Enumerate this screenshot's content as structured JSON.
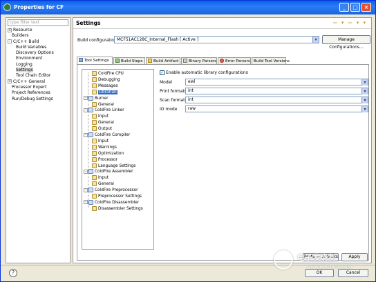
{
  "window": {
    "title": "Properties for CF"
  },
  "filter": {
    "placeholder": "type filter text"
  },
  "nav": [
    {
      "label": "Resource",
      "toggle": "+",
      "indent": 0
    },
    {
      "label": "Builders",
      "toggle": "",
      "indent": 1
    },
    {
      "label": "C/C++ Build",
      "toggle": "-",
      "indent": 0
    },
    {
      "label": "Build Variables",
      "toggle": "",
      "indent": 2
    },
    {
      "label": "Discovery Options",
      "toggle": "",
      "indent": 2
    },
    {
      "label": "Environment",
      "toggle": "",
      "indent": 2
    },
    {
      "label": "Logging",
      "toggle": "",
      "indent": 2
    },
    {
      "label": "Settings",
      "toggle": "",
      "indent": 2,
      "selected": true
    },
    {
      "label": "Tool Chain Editor",
      "toggle": "",
      "indent": 2
    },
    {
      "label": "C/C++ General",
      "toggle": "+",
      "indent": 0
    },
    {
      "label": "Processor Expert",
      "toggle": "",
      "indent": 1
    },
    {
      "label": "Project References",
      "toggle": "",
      "indent": 1
    },
    {
      "label": "Run/Debug Settings",
      "toggle": "",
      "indent": 1
    }
  ],
  "header": {
    "title": "Settings",
    "nav_arrows": "⇦ ▾ ⇨ ▾ ▾"
  },
  "build_config": {
    "label": "Build configuration:",
    "value": "MCF51AC128C_Internal_Flash  [ Active ]",
    "manage_label": "Manage Configurations..."
  },
  "tabs": [
    {
      "label": "Tool Settings",
      "active": true
    },
    {
      "label": "Build Steps"
    },
    {
      "label": "Build Artifact"
    },
    {
      "label": "Binary Parsers"
    },
    {
      "label": "Error Parsers"
    },
    {
      "label": "Build Tool Versions"
    }
  ],
  "tool_tree": [
    {
      "label": "ColdFire CPU",
      "level": 1,
      "icon": "tool"
    },
    {
      "label": "Debugging",
      "level": 1,
      "icon": "tool"
    },
    {
      "label": "Messages",
      "level": 1,
      "icon": "tool"
    },
    {
      "label": "Librarian",
      "level": 1,
      "icon": "tool",
      "selected": true
    },
    {
      "label": "Burner",
      "level": 0,
      "toggle": "-",
      "icon": "gear"
    },
    {
      "label": "General",
      "level": 1,
      "icon": "tool"
    },
    {
      "label": "ColdFire Linker",
      "level": 0,
      "toggle": "-",
      "icon": "gear"
    },
    {
      "label": "Input",
      "level": 1,
      "icon": "tool"
    },
    {
      "label": "General",
      "level": 1,
      "icon": "tool"
    },
    {
      "label": "Output",
      "level": 1,
      "icon": "tool"
    },
    {
      "label": "ColdFire Compiler",
      "level": 0,
      "toggle": "-",
      "icon": "gear"
    },
    {
      "label": "Input",
      "level": 1,
      "icon": "tool"
    },
    {
      "label": "Warnings",
      "level": 1,
      "icon": "tool"
    },
    {
      "label": "Optimization",
      "level": 1,
      "icon": "tool"
    },
    {
      "label": "Processor",
      "level": 1,
      "icon": "tool"
    },
    {
      "label": "Language Settings",
      "level": 1,
      "icon": "tool"
    },
    {
      "label": "ColdFire Assembler",
      "level": 0,
      "toggle": "-",
      "icon": "gear"
    },
    {
      "label": "Input",
      "level": 1,
      "icon": "tool"
    },
    {
      "label": "General",
      "level": 1,
      "icon": "tool"
    },
    {
      "label": "ColdFire Preprocessor",
      "level": 0,
      "toggle": "-",
      "icon": "gear"
    },
    {
      "label": "Preprocessor Settings",
      "level": 1,
      "icon": "tool"
    },
    {
      "label": "ColdFire Disassembler",
      "level": 0,
      "toggle": "-",
      "icon": "gear"
    },
    {
      "label": "Disassembler Settings",
      "level": 1,
      "icon": "tool"
    }
  ],
  "librarian": {
    "enable_label": "Enable automatic library configurations",
    "enable_checked": true,
    "fields": [
      {
        "label": "Model",
        "value": "ewl"
      },
      {
        "label": "Print formats",
        "value": "int"
      },
      {
        "label": "Scan formats",
        "value": "int"
      },
      {
        "label": "IO mode",
        "value": "raw"
      }
    ]
  },
  "buttons": {
    "restore_defaults": "Restore Defaults",
    "apply": "Apply",
    "ok": "OK",
    "cancel": "Cancel"
  },
  "watermark": {
    "line1": "电子发烧友",
    "line2": "www.elecfans.com"
  }
}
